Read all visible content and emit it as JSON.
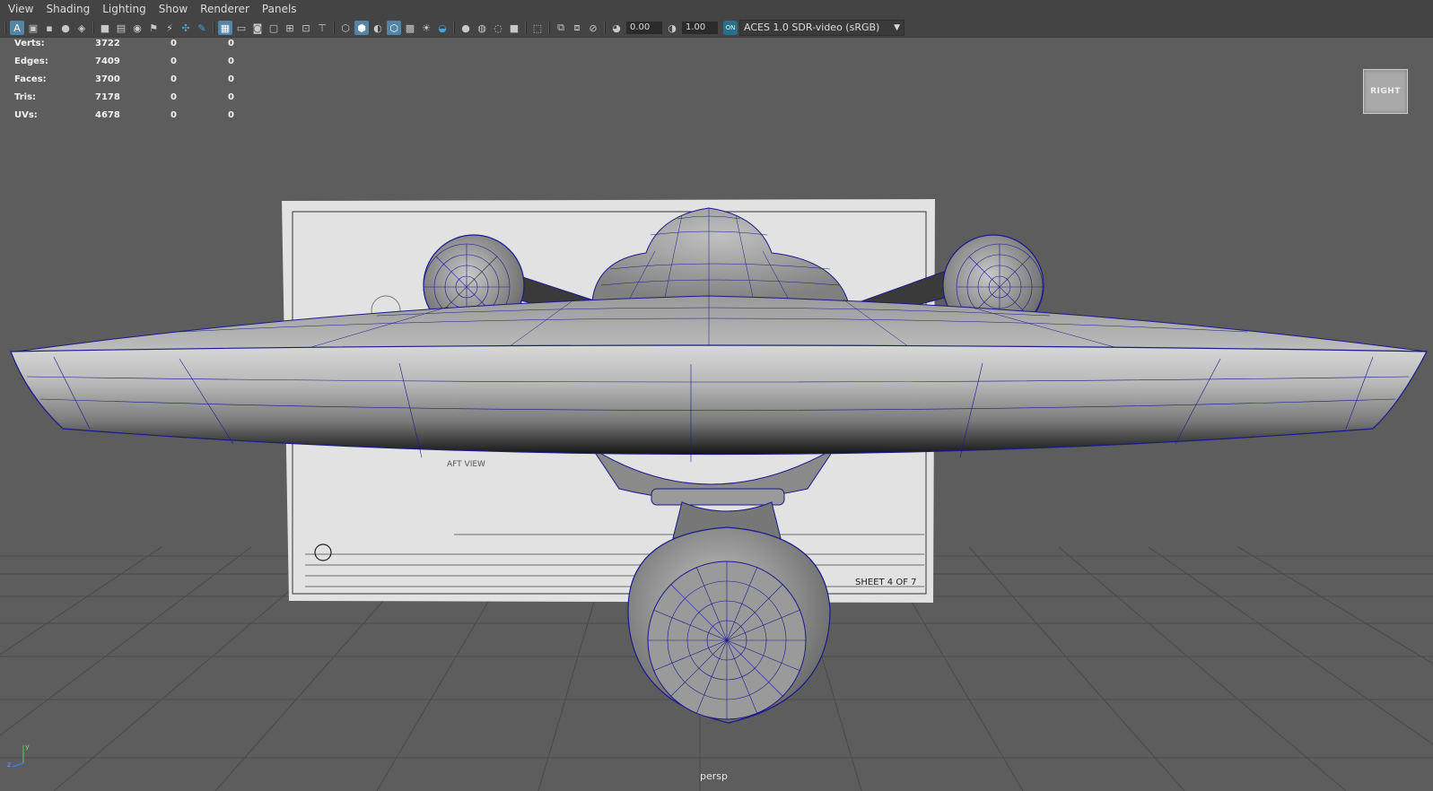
{
  "menubar": {
    "items": [
      "View",
      "Shading",
      "Lighting",
      "Show",
      "Renderer",
      "Panels"
    ]
  },
  "toolbar": {
    "exposure": "0.00",
    "gamma": "1.00",
    "color_space": "ACES 1.0 SDR-video (sRGB)"
  },
  "hud": {
    "rows": [
      {
        "label": "Verts:",
        "v1": "3722",
        "v2": "0",
        "v3": "0"
      },
      {
        "label": "Edges:",
        "v1": "7409",
        "v2": "0",
        "v3": "0"
      },
      {
        "label": "Faces:",
        "v1": "3700",
        "v2": "0",
        "v3": "0"
      },
      {
        "label": "Tris:",
        "v1": "7178",
        "v2": "0",
        "v3": "0"
      },
      {
        "label": "UVs:",
        "v1": "4678",
        "v2": "0",
        "v3": "0"
      }
    ]
  },
  "viewcube": {
    "label": "RIGHT"
  },
  "viewport": {
    "camera": "persp"
  },
  "blueprint": {
    "sheet": "SHEET 4 OF 7",
    "view_label": "AFT VIEW"
  },
  "axis": {
    "y": "y",
    "z": "z"
  },
  "colors": {
    "wire": "#1a1a8c",
    "background": "#5d5d5d",
    "grid": "#4b4b4b",
    "accent": "#5285a6"
  }
}
